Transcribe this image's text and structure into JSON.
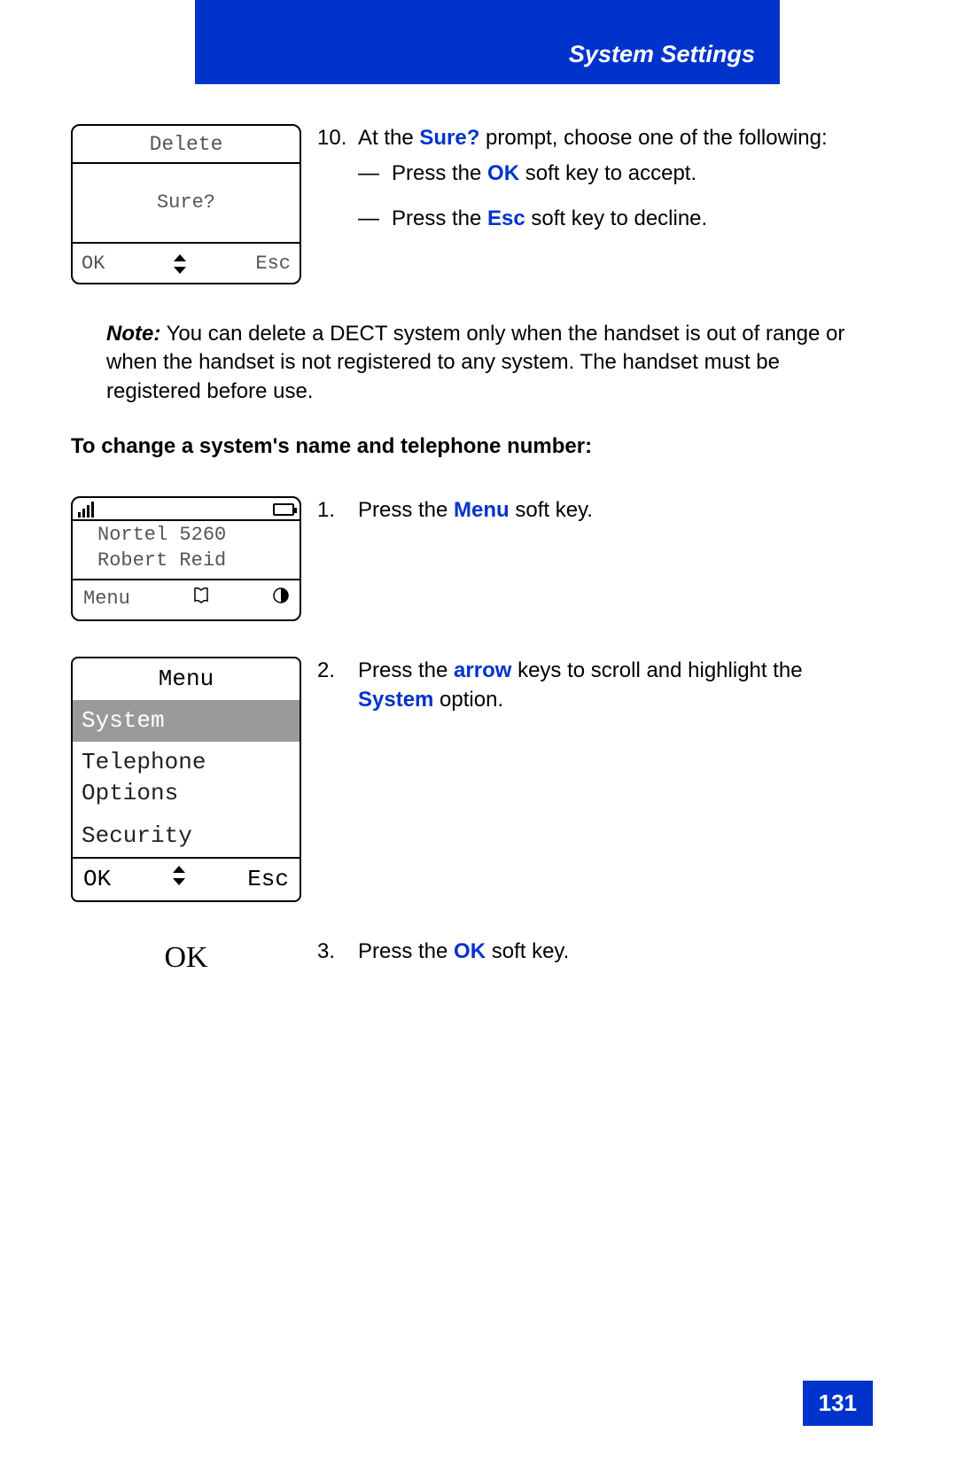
{
  "header": {
    "section_title": "System Settings"
  },
  "page_number": "131",
  "step10": {
    "number": "10.",
    "text_1": "At the ",
    "sure_label": "Sure?",
    "text_2": " prompt, choose one of the following:",
    "dash": "—",
    "opt1_pre": "Press the ",
    "opt1_key": "OK",
    "opt1_post": " soft key to accept.",
    "opt2_pre": "Press the ",
    "opt2_key": "Esc",
    "opt2_post": " soft key to decline."
  },
  "screen1": {
    "title": "Delete",
    "prompt": "Sure?",
    "left": "OK",
    "right": "Esc"
  },
  "note": {
    "label": "Note:",
    "body": " You can delete a DECT system only when the handset is out of range or when the handset is not registered to any system. The handset must be registered before use."
  },
  "section_heading": "To change a system's name and telephone number:",
  "screen2": {
    "line1": "Nortel 5260",
    "line2": "Robert Reid",
    "left": "Menu"
  },
  "step1": {
    "number": "1.",
    "pre": "Press the ",
    "key": "Menu",
    "post": " soft key."
  },
  "screen3": {
    "title": "Menu",
    "item_selected": "System",
    "item2": "Telephone Options",
    "item3": "Security",
    "left": "OK",
    "right": "Esc"
  },
  "step2": {
    "number": "2.",
    "pre": "Press the ",
    "key1": "arrow",
    "mid": " keys to scroll and highlight the ",
    "key2": "System",
    "post": " option."
  },
  "step3": {
    "ok_label": "OK",
    "number": "3.",
    "pre": "Press the ",
    "key": "OK",
    "post": " soft key."
  }
}
